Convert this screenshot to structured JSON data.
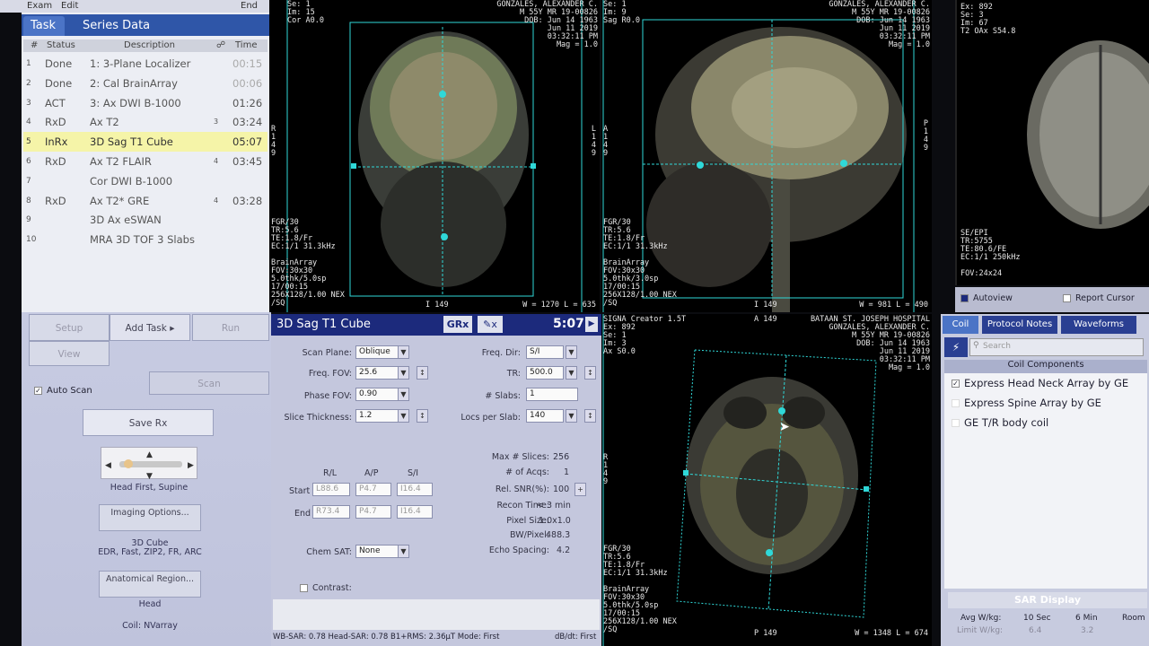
{
  "menu": {
    "exam": "Exam",
    "edit": "Edit",
    "end": "End"
  },
  "tabs": {
    "task": "Task",
    "series": "Series Data"
  },
  "task_header": {
    "num": "#",
    "status": "Status",
    "desc": "Description",
    "time": "Time"
  },
  "tasks": [
    {
      "n": "1",
      "status": "Done",
      "desc": "1: 3-Plane Localizer",
      "badge": "",
      "time": "00:15"
    },
    {
      "n": "2",
      "status": "Done",
      "desc": "2: Cal BrainArray",
      "badge": "",
      "time": "00:06"
    },
    {
      "n": "3",
      "status": "ACT",
      "desc": "3: Ax DWI B-1000",
      "badge": "",
      "time": "01:26"
    },
    {
      "n": "4",
      "status": "RxD",
      "desc": "Ax T2",
      "badge": "3",
      "time": "03:24"
    },
    {
      "n": "5",
      "status": "InRx",
      "desc": "3D Sag T1 Cube",
      "badge": "",
      "time": "05:07"
    },
    {
      "n": "6",
      "status": "RxD",
      "desc": "Ax T2 FLAIR",
      "badge": "4",
      "time": "03:45"
    },
    {
      "n": "7",
      "status": "",
      "desc": "Cor DWI B-1000",
      "badge": "",
      "time": ""
    },
    {
      "n": "8",
      "status": "RxD",
      "desc": "Ax T2* GRE",
      "badge": "4",
      "time": "03:28"
    },
    {
      "n": "9",
      "status": "",
      "desc": "3D Ax eSWAN",
      "badge": "",
      "time": ""
    },
    {
      "n": "10",
      "status": "",
      "desc": "MRA 3D TOF 3 Slabs",
      "badge": "",
      "time": ""
    }
  ],
  "controls": {
    "setup": "Setup",
    "add_task": "Add Task",
    "run": "Run",
    "view": "View",
    "scan": "Scan",
    "auto_scan": "Auto Scan",
    "save_rx": "Save Rx",
    "patient_position": "Head First, Supine",
    "imaging_options": "Imaging Options...",
    "options_line1": "3D Cube",
    "options_line2": "EDR, Fast, ZIP2, FR, ARC",
    "anatomical_region": "Anatomical Region...",
    "region_value": "Head",
    "coil": "Coil: NVarray"
  },
  "protocol": {
    "title": "3D Sag T1 Cube",
    "grx": "GRx",
    "time": "5:07",
    "scan_plane_label": "Scan Plane:",
    "scan_plane": "Oblique",
    "freq_fov_label": "Freq. FOV:",
    "freq_fov": "25.6",
    "phase_fov_label": "Phase FOV:",
    "phase_fov": "0.90",
    "slice_thickness_label": "Slice Thickness:",
    "slice_thickness": "1.2",
    "freq_dir_label": "Freq. Dir:",
    "freq_dir": "S/I",
    "tr_label": "TR:",
    "tr": "500.0",
    "slabs_label": "# Slabs:",
    "slabs": "1",
    "locs_label": "Locs per Slab:",
    "locs": "140",
    "rl": "R/L",
    "ap": "A/P",
    "si": "S/I",
    "start_label": "Start",
    "start": [
      "L88.6",
      "P4.7",
      "I16.4"
    ],
    "end_label": "End",
    "end": [
      "R73.4",
      "P4.7",
      "I16.4"
    ],
    "max_slices_label": "Max # Slices:",
    "max_slices": "256",
    "acqs_label": "# of Acqs:",
    "acqs": "1",
    "snr_label": "Rel. SNR(%):",
    "snr": "100",
    "recon_label": "Recon Time:",
    "recon": "< 3 min",
    "pixel_label": "Pixel Size:",
    "pixel": "1.0x1.0",
    "bw_label": "BW/Pixel:",
    "bw": "488.3",
    "echo_label": "Echo Spacing:",
    "echo": "4.2",
    "chemsat_label": "Chem SAT:",
    "chemsat": "None",
    "contrast_label": "Contrast:",
    "status_line": "WB-SAR: 0.78  Head-SAR: 0.78  B1+RMS: 2.36µT  Mode: First",
    "status_right": "dB/dt: First"
  },
  "viewport1": {
    "tl": "Se: 1\nIm: 15\nCor A0.0",
    "tr": "GONZALES, ALEXANDER C.\nM 55Y MR 19-00826\nDOB: Jun 14 1963\nJun 11 2019\n03:32:11 PM\nMag = 1.0",
    "bl": "FGR/30\nTR:5.6\nTE:1.8/Fr\nEC:1/1 31.3kHz\n\nBrainArray\nFOV:30x30\n5.0thk/5.0sp\n17/00:15\n256X128/1.00 NEX\n/SQ",
    "bottom": "I 149",
    "wl": "W = 1270 L = 635",
    "lm": "R\n1\n4\n9",
    "rm": "L\n1\n4\n9"
  },
  "viewport2": {
    "tl": "Se: 1\nIm: 9\nSag R0.0",
    "tr": "GONZALES, ALEXANDER C.\nM 55Y MR 19-00826\nDOB: Jun 14 1963\nJun 11 2019\n03:32:11 PM\nMag = 1.0",
    "bl": "FGR/30\nTR:5.6\nTE:1.8/Fr\nEC:1/1 31.3kHz\n\nBrainArray\nFOV:30x30\n5.0thk/3.0sp\n17/00:15\n256X128/1.00 NEX\n/SQ",
    "bottom": "I 149",
    "wl": "W = 981 L = 490",
    "lm": "A\n1\n4\n9",
    "rm": "P\n1\n4\n9"
  },
  "viewport3": {
    "tl": "SIGNA Creator 1.5T\nEx: 892\nSe: 1\nIm: 3\nAx S0.0",
    "top": "A 149",
    "tr": "BATAAN ST. JOSEPH HOSPITAL\nGONZALES, ALEXANDER C.\nM 55Y MR 19-00826\nDOB: Jun 14 1963\nJun 11 2019\n03:32:11 PM\nMag = 1.0",
    "bl": "FGR/30\nTR:5.6\nTE:1.8/Fr\nEC:1/1 31.3kHz\n\nBrainArray\nFOV:30x30\n5.0thk/5.0sp\n17/00:15\n256X128/1.00 NEX\n/SQ",
    "bottom": "P 149",
    "wl": "W = 1348 L = 674",
    "lm": "R\n1\n4\n9"
  },
  "viewport4": {
    "tl": "Ex: 892\nSe: 3\nIm: 67\nT2 OAx S54.8",
    "bl": "SE/EPI\nTR:5755\nTE:80.6/FE\nEC:1/1 250kHz\n\nFOV:24x24"
  },
  "autoview": "Autoview",
  "report_cursor": "Report Cursor",
  "coil_tabs": {
    "coil": "Coil",
    "protocol_notes": "Protocol Notes",
    "waveforms": "Waveforms"
  },
  "coil_search_placeholder": "Search",
  "coil_components_title": "Coil Components",
  "coils": [
    "Express Head Neck Array by GE",
    "Express Spine Array by GE",
    "GE T/R body coil"
  ],
  "sar": {
    "title": "SAR Display",
    "avg": "Avg W/kg:",
    "sec": "10 Sec",
    "min": "6 Min",
    "room": "Room",
    "limit": "Limit W/kg:",
    "v1": "6.4",
    "v2": "3.2"
  },
  "colors": {
    "task_tab_bar": "#2f56a8",
    "protocol_title": "#1c2a7c",
    "highlight": "#f5f4a8",
    "graphic_rx": "#2fd8d8"
  }
}
